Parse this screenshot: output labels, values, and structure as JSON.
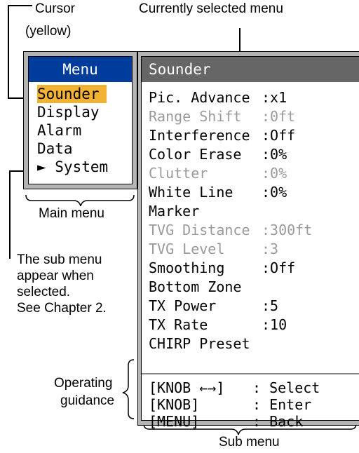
{
  "callouts": {
    "cursor": "Cursor",
    "cursor_color": "(yellow)",
    "current_menu": "Currently selected menu",
    "main_menu": "Main menu",
    "sub_note": [
      "The sub menu",
      "appear when",
      "selected.",
      "See Chapter 2."
    ],
    "operating": "Operating",
    "guidance": "guidance",
    "sub_menu": "Sub menu"
  },
  "main_menu": {
    "title": "Menu",
    "items": [
      {
        "label": "Sounder",
        "selected": true
      },
      {
        "label": "Display"
      },
      {
        "label": "Alarm"
      },
      {
        "label": "Data"
      },
      {
        "label": "► System"
      }
    ]
  },
  "sub_menu": {
    "title": "Sounder",
    "items": [
      {
        "name": "Pic. Advance",
        "value": ":x1",
        "enabled": true
      },
      {
        "name": "Range Shift",
        "value": ":0ft",
        "enabled": false
      },
      {
        "name": "Interference",
        "value": ":Off",
        "enabled": true
      },
      {
        "name": "Color Erase",
        "value": ":0%",
        "enabled": true
      },
      {
        "name": "Clutter",
        "value": ":0%",
        "enabled": false
      },
      {
        "name": "White Line",
        "value": ":0%",
        "enabled": true
      },
      {
        "name": "Marker",
        "value": "",
        "enabled": true
      },
      {
        "name": "TVG Distance",
        "value": ":300ft",
        "enabled": false
      },
      {
        "name": "TVG Level",
        "value": ":3",
        "enabled": false
      },
      {
        "name": "Smoothing",
        "value": ":Off",
        "enabled": true
      },
      {
        "name": "Bottom Zone",
        "value": "",
        "enabled": true
      },
      {
        "name": "TX Power",
        "value": ":5",
        "enabled": true
      },
      {
        "name": "TX Rate",
        "value": ":10",
        "enabled": true
      },
      {
        "name": "CHIRP Preset",
        "value": "",
        "enabled": true
      }
    ],
    "guidance": [
      {
        "key": "[KNOB ←→]",
        "action": ": Select"
      },
      {
        "key": "[KNOB]",
        "action": ": Enter"
      },
      {
        "key": "[MENU]",
        "action": ": Back"
      }
    ]
  },
  "colors": {
    "main_title_bg": "#003c9c",
    "sub_title_bg": "#666666",
    "cursor_highlight": "#f2b233",
    "disabled_text": "#9a9a9a"
  }
}
